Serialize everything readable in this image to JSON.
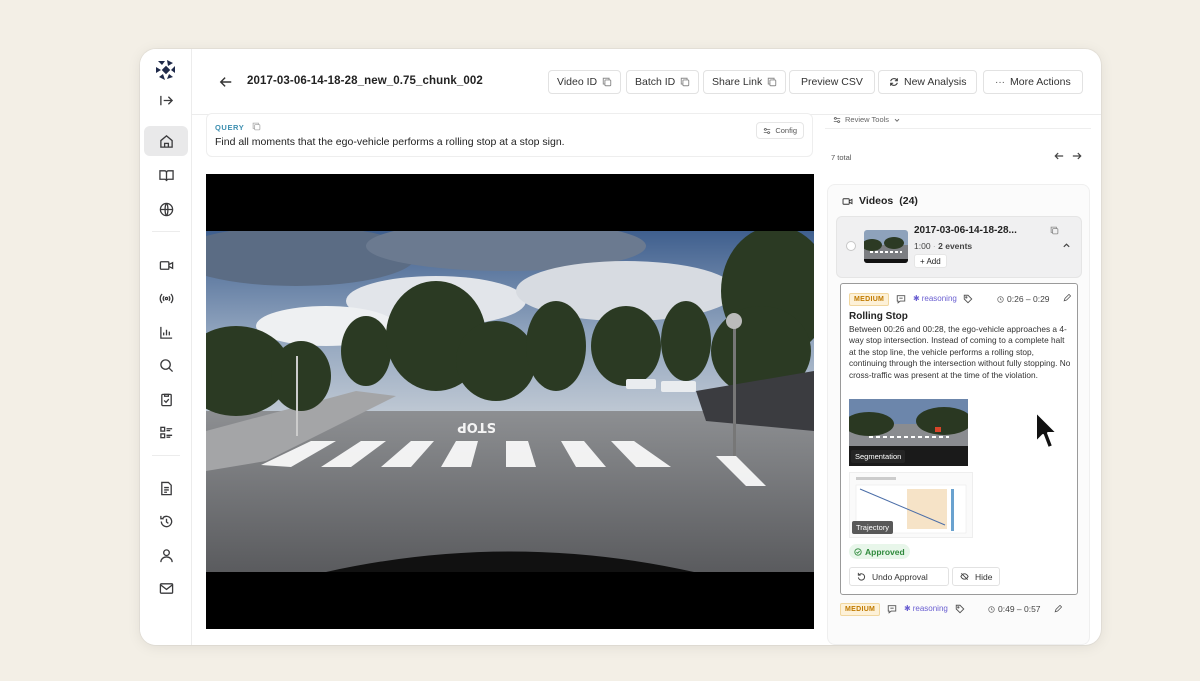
{
  "header": {
    "title": "2017-03-06-14-18-28_new_0.75_chunk_002",
    "buttons": {
      "video_id": "Video ID",
      "batch_id": "Batch ID",
      "share_link": "Share Link",
      "preview_csv": "Preview CSV",
      "new_analysis": "New Analysis",
      "more_actions": "More Actions"
    }
  },
  "query": {
    "label": "QUERY",
    "text": "Find all moments that the ego-vehicle performs a rolling stop at a stop sign.",
    "config": "Config"
  },
  "review": {
    "tools_label": "Review Tools",
    "total": "7 total"
  },
  "videos": {
    "heading": "Videos",
    "count": "(24)",
    "item": {
      "title": "2017-03-06-14-18-28...",
      "duration": "1:00",
      "events": "2 events",
      "add": "+ Add"
    }
  },
  "events": [
    {
      "severity": "MEDIUM",
      "tag": "reasoning",
      "time": "0:26 – 0:29",
      "title": "Rolling Stop",
      "description": "Between 00:26 and 00:28, the ego-vehicle approaches a 4-way stop intersection. Instead of coming to a complete halt at the stop line, the vehicle performs a rolling stop, continuing through the intersection without fully stopping. No cross-traffic was present at the time of the violation.",
      "segmentation_label": "Segmentation",
      "trajectory_label": "Trajectory",
      "status": "Approved",
      "undo": "Undo Approval",
      "hide": "Hide"
    },
    {
      "severity": "MEDIUM",
      "tag": "reasoning",
      "time": "0:49 – 0:57"
    }
  ],
  "scene": {
    "road_marking": "STOP"
  },
  "colors": {
    "background": "#f3efe6",
    "accent_query": "#3d8fb0",
    "severity_medium": "#c07a00",
    "approved": "#2f8a3c",
    "reasoning": "#6a5fd1"
  }
}
